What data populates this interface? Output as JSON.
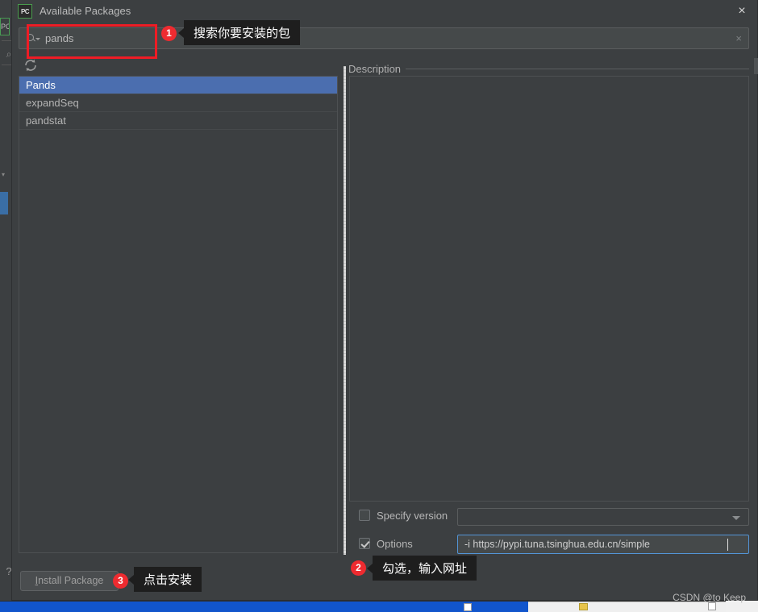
{
  "window": {
    "title": "Available Packages",
    "app_icon": "pycharm-icon",
    "app_icon_text": "PC",
    "close_icon": "×"
  },
  "search": {
    "value": "pands",
    "clear_icon": "×",
    "icon": "search-icon"
  },
  "toolbar": {
    "refresh_icon": "refresh-icon"
  },
  "packages": [
    {
      "name": "Pands",
      "selected": true
    },
    {
      "name": "expandSeq",
      "selected": false
    },
    {
      "name": "pandstat",
      "selected": false
    }
  ],
  "description": {
    "label": "Description",
    "body": ""
  },
  "options": {
    "specify_version_label": "Specify version",
    "specify_version_checked": false,
    "version_value": "",
    "options_label": "Options",
    "options_checked": true,
    "options_value": "-i https://pypi.tuna.tsinghua.edu.cn/simple"
  },
  "footer": {
    "install_label": "Install Package",
    "install_mnemonic": "I",
    "install_rest": "nstall Package"
  },
  "watermark": "CSDN @to Keep",
  "annotations": [
    {
      "number": "1",
      "text": "搜索你要安装的包"
    },
    {
      "number": "2",
      "text": "勾选，输入网址"
    },
    {
      "number": "3",
      "text": "点击安装"
    }
  ],
  "colors": {
    "accent_red": "#ee2b30",
    "selection_blue": "#4b6eaf",
    "focus_blue": "#5394d6",
    "panel_bg": "#3c3f41"
  },
  "backdrop": {
    "pc_tab": "PC",
    "help_icon": "?",
    "search_icon": "⌕"
  }
}
